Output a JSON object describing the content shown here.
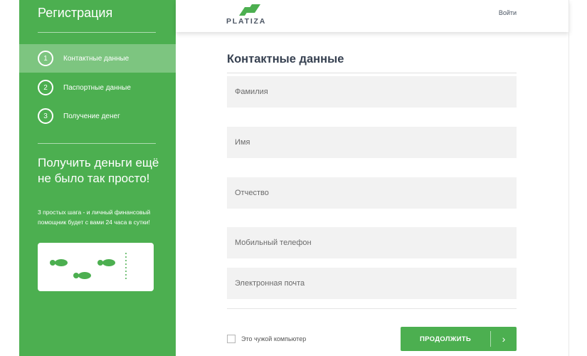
{
  "sidebar": {
    "title": "Регистрация",
    "steps": [
      {
        "number": "1",
        "label": "Контактные данные",
        "active": true
      },
      {
        "number": "2",
        "label": "Паспортные данные",
        "active": false
      },
      {
        "number": "3",
        "label": "Получение денег",
        "active": false
      }
    ],
    "promo_title": "Получить деньги ещё не было так просто!",
    "promo_text": "3 простых шага - и личный финансовый помощник будет с вами 24 часа в сутки!",
    "promo_icon": "footsteps-icon"
  },
  "header": {
    "logo_text": "PLATIZA",
    "login_label": "Войти"
  },
  "form": {
    "title": "Контактные данные",
    "fields": [
      {
        "name": "last-name",
        "placeholder": "Фамилия",
        "value": ""
      },
      {
        "name": "first-name",
        "placeholder": "Имя",
        "value": ""
      },
      {
        "name": "patronymic",
        "placeholder": "Отчество",
        "value": ""
      },
      {
        "name": "mobile-phone",
        "placeholder": "Мобильный телефон",
        "value": ""
      },
      {
        "name": "email",
        "placeholder": "Электронная почта",
        "value": ""
      }
    ],
    "checkbox_label": "Это чужой компьютер",
    "continue_label": "ПРОДОЛЖИТЬ",
    "continue_arrow": "›"
  },
  "colors": {
    "brand_green": "#4caf50",
    "text_dark": "#374151",
    "field_bg": "#f2f2f2"
  }
}
